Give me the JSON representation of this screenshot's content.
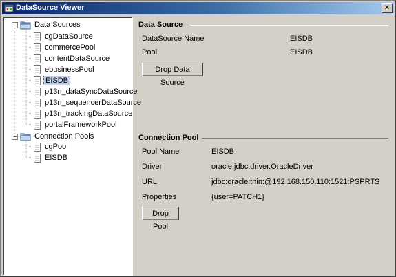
{
  "window": {
    "title": "DataSource Viewer",
    "close_glyph": "✕"
  },
  "tree": {
    "data_sources": {
      "label": "Data Sources",
      "expander": "−",
      "items": [
        "cgDataSource",
        "commercePool",
        "contentDataSource",
        "ebusinessPool",
        "EISDB",
        "p13n_dataSyncDataSource",
        "p13n_sequencerDataSource",
        "p13n_trackingDataSource",
        "portalFrameworkPool"
      ],
      "selected_index": 4
    },
    "connection_pools": {
      "label": "Connection Pools",
      "expander": "−",
      "items": [
        "cgPool",
        "EISDB"
      ]
    }
  },
  "data_source": {
    "section_title": "Data Source",
    "name_label": "DataSource Name",
    "name_value": "EISDB",
    "pool_label": "Pool",
    "pool_value": "EISDB",
    "drop_button": "Drop Data Source"
  },
  "connection_pool": {
    "section_title": "Connection Pool",
    "pool_name_label": "Pool Name",
    "pool_name_value": "EISDB",
    "driver_label": "Driver",
    "driver_value": "oracle.jdbc.driver.OracleDriver",
    "url_label": "URL",
    "url_value": "jdbc:oracle:thin:@192.168.150.110:1521:PSPRTS",
    "properties_label": "Properties",
    "properties_value": "{user=PATCH1}",
    "drop_button": "Drop Pool"
  },
  "colors": {
    "title_gradient_start": "#0a246a",
    "title_gradient_end": "#a6caf0",
    "face": "#d4d0c8",
    "selection": "#c4d1e6"
  }
}
